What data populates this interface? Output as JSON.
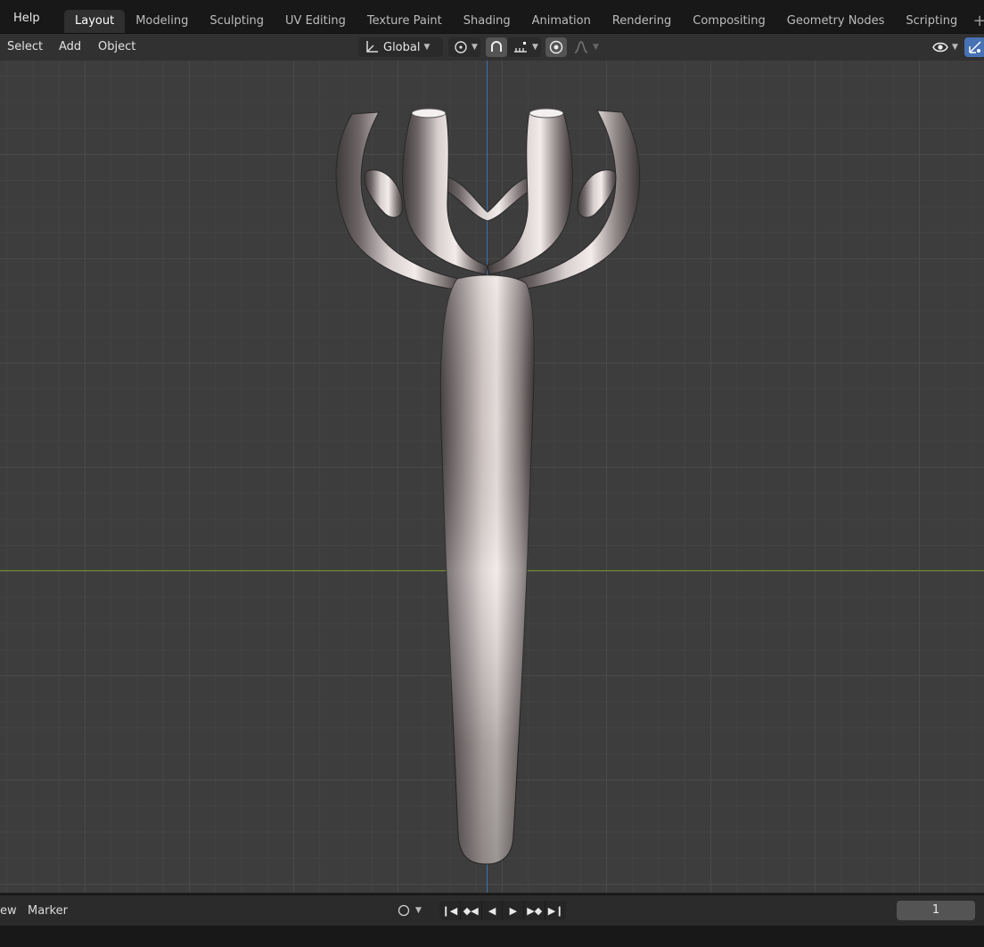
{
  "top_menu": {
    "help": "Help"
  },
  "workspace_tabs": [
    {
      "label": "Layout",
      "active": true
    },
    {
      "label": "Modeling"
    },
    {
      "label": "Sculpting"
    },
    {
      "label": "UV Editing"
    },
    {
      "label": "Texture Paint"
    },
    {
      "label": "Shading"
    },
    {
      "label": "Animation"
    },
    {
      "label": "Rendering"
    },
    {
      "label": "Compositing"
    },
    {
      "label": "Geometry Nodes"
    },
    {
      "label": "Scripting"
    }
  ],
  "add_workspace_icon": "plus-icon",
  "viewport_header": {
    "menus": [
      "Select",
      "Add",
      "Object"
    ],
    "transform_orientation": "Global",
    "icons": [
      "transform-orientation-icon",
      "pivot-point-icon",
      "snap-icon",
      "snap-increment-icon",
      "proportional-edit-icon",
      "falloff-curve-icon",
      "visibility-icon",
      "gizmo-icon"
    ]
  },
  "grid_colors": {
    "x_axis": "#6f8f2a",
    "y_axis": "#3f6fb0",
    "background": "#3d3d3d"
  },
  "timeline": {
    "view_label": "ew",
    "marker_label": "Marker",
    "current_frame": "1",
    "playback_icons": [
      "jump-to-start-icon",
      "previous-keyframe-icon",
      "play-reverse-icon",
      "play-icon",
      "next-keyframe-icon",
      "jump-to-end-icon"
    ]
  }
}
